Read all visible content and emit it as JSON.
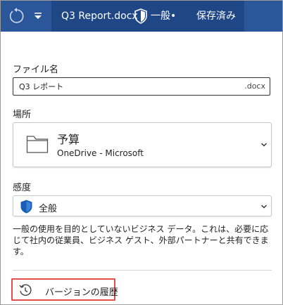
{
  "titlebar": {
    "document_name": "Q3 Report.docx",
    "sensitivity": "一般•",
    "save_status": "保存済み"
  },
  "panel": {
    "filename_label": "ファイル名",
    "filename_value": "Q3 レポート",
    "filename_extension": ".docx",
    "location_label": "場所",
    "location_name": "予算",
    "location_path": "OneDrive - Microsoft",
    "sensitivity_label": "感度",
    "sensitivity_value": "全般",
    "sensitivity_description": "一般の使用を目的としていないビジネス データ。これは、必要に応じて社内の従業員、ビジネス ゲスト、外部パートナーと共有できます。",
    "version_history_label": "バージョンの履歴"
  },
  "colors": {
    "titlebar": "#2b579a",
    "titlebar_dark": "#1f4786",
    "shield": "#1a5fb4",
    "highlight": "#e54c4c"
  }
}
